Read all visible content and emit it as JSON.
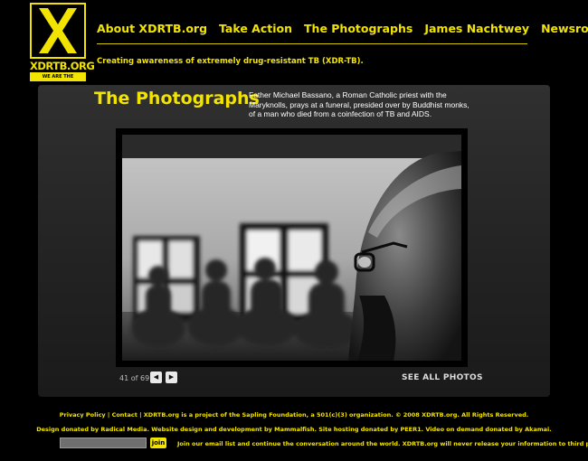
{
  "logo": {
    "mark": "X",
    "name": "XDRTB.ORG",
    "tag": "WE ARE THE TREATMENT"
  },
  "nav": {
    "items": [
      {
        "label": "About XDRTB.org"
      },
      {
        "label": "Take Action"
      },
      {
        "label": "The Photographs"
      },
      {
        "label": "James Nachtwey"
      },
      {
        "label": "Newsroom"
      }
    ]
  },
  "tagline": "Creating awareness of extremely drug-resistant TB (XDR-TB).",
  "gallery": {
    "title": "The Photographs",
    "caption": "Father Michael Bassano, a Roman Catholic priest with the Maryknolls, prays at a funeral, presided over by Buddhist monks, of a man who died from a coinfection of TB and AIDS.",
    "counter": "41 of 69",
    "current": 41,
    "total": 69,
    "prev_icon": "triangle-left-icon",
    "next_icon": "triangle-right-icon",
    "see_all_label": "SEE ALL PHOTOS"
  },
  "footer": {
    "line1": "Privacy Policy | Contact | XDRTB.org is a project of the Sapling Foundation, a 501(c)(3) organization. © 2008 XDRTB.org. All Rights Reserved.",
    "line2": "Design donated by Radical Media. Website design and development by Mammalfish. Site hosting donated by PEER1. Video on demand donated by Akamai.",
    "email_value": "",
    "join_label": "join",
    "line3": "Join our email list and continue the conversation around the world.  XDRTB.org will never release your information to third parties."
  },
  "colors": {
    "accent": "#f2e400",
    "background": "#000000",
    "panel": "#2a2a2a"
  }
}
